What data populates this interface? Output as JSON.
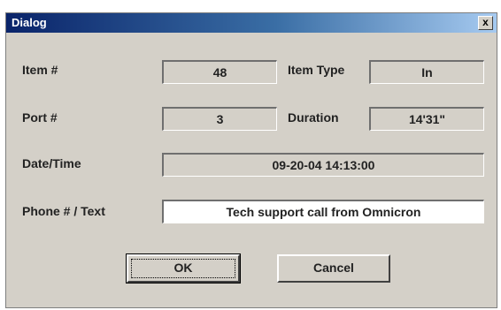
{
  "window": {
    "title": "Dialog",
    "close_glyph": "x"
  },
  "fields": {
    "item_number": {
      "label": "Item #",
      "value": "48"
    },
    "item_type": {
      "label": "Item Type",
      "value": "In"
    },
    "port_number": {
      "label": "Port #",
      "value": "3"
    },
    "duration": {
      "label": "Duration",
      "value": "14'31\""
    },
    "date_time": {
      "label": "Date/Time",
      "value": "09-20-04 14:13:00"
    },
    "phone_text": {
      "label": "Phone # / Text",
      "value": "Tech support call from Omnicron"
    }
  },
  "buttons": {
    "ok": "OK",
    "cancel": "Cancel"
  }
}
